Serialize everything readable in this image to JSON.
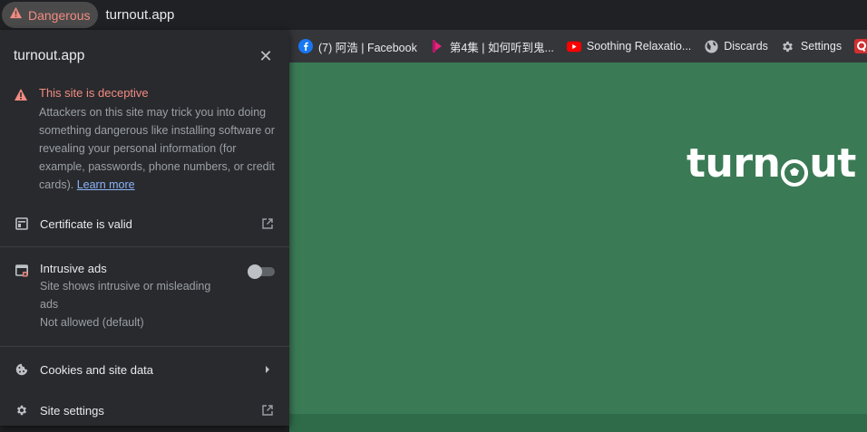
{
  "address_bar": {
    "security_chip": "Dangerous",
    "url": "turnout.app"
  },
  "bookmarks": [
    {
      "label": "(7) 阿浩 | Facebook",
      "icon": "facebook-icon"
    },
    {
      "label": "第4集 | 如何听到鬼...",
      "icon": "bilibili-icon"
    },
    {
      "label": "Soothing Relaxatio...",
      "icon": "youtube-icon"
    },
    {
      "label": "Discards",
      "icon": "globe-icon"
    },
    {
      "label": "Settings",
      "icon": "gear-icon"
    }
  ],
  "page": {
    "logo_text_a": "turn",
    "logo_text_b": "ut"
  },
  "popup": {
    "title": "turnout.app",
    "warning": {
      "title": "This site is deceptive",
      "description": "Attackers on this site may trick you into doing something dangerous like installing software or revealing your personal information (for example, passwords, phone numbers, or credit cards).",
      "learn_more": "Learn more"
    },
    "certificate_label": "Certificate is valid",
    "intrusive_ads": {
      "title": "Intrusive ads",
      "description": "Site shows intrusive or misleading ads",
      "status": "Not allowed (default)",
      "enabled": false
    },
    "cookies_label": "Cookies and site data",
    "site_settings_label": "Site settings"
  },
  "colors": {
    "danger": "#f28b82",
    "link": "#8ab4f8",
    "page_green": "#3a7a55"
  }
}
